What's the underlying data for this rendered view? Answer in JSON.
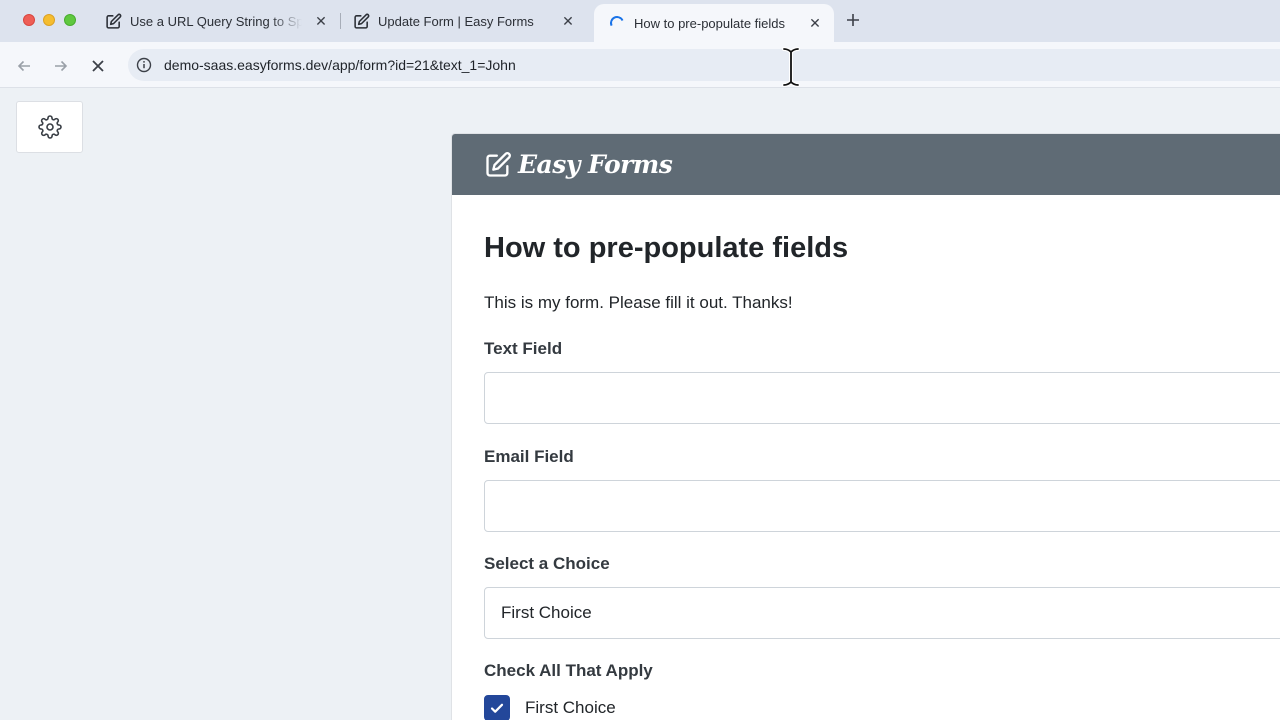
{
  "browser": {
    "tabs": [
      {
        "title": "Use a URL Query String to Sp",
        "favicon": "edit-square-icon",
        "active": false
      },
      {
        "title": "Update Form | Easy Forms",
        "favicon": "edit-square-icon",
        "active": false
      },
      {
        "title": "How to pre-populate fields",
        "favicon": "loading-spinner-icon",
        "active": true
      }
    ],
    "url": "demo-saas.easyforms.dev/app/form?id=21&text_1=John",
    "accent_color": "#1a73e8"
  },
  "form": {
    "brand": "Easy Forms",
    "header_color": "#5f6b75",
    "title": "How to pre-populate fields",
    "description": "This is my form. Please fill it out. Thanks!",
    "text_field": {
      "label": "Text Field",
      "value": ""
    },
    "email_field": {
      "label": "Email Field",
      "value": ""
    },
    "select_field": {
      "label": "Select a Choice",
      "value": "First Choice"
    },
    "checkbox_group": {
      "label": "Check All That Apply",
      "options": [
        {
          "label": "First Choice",
          "checked": true
        }
      ],
      "checked_color": "#23479a"
    }
  }
}
